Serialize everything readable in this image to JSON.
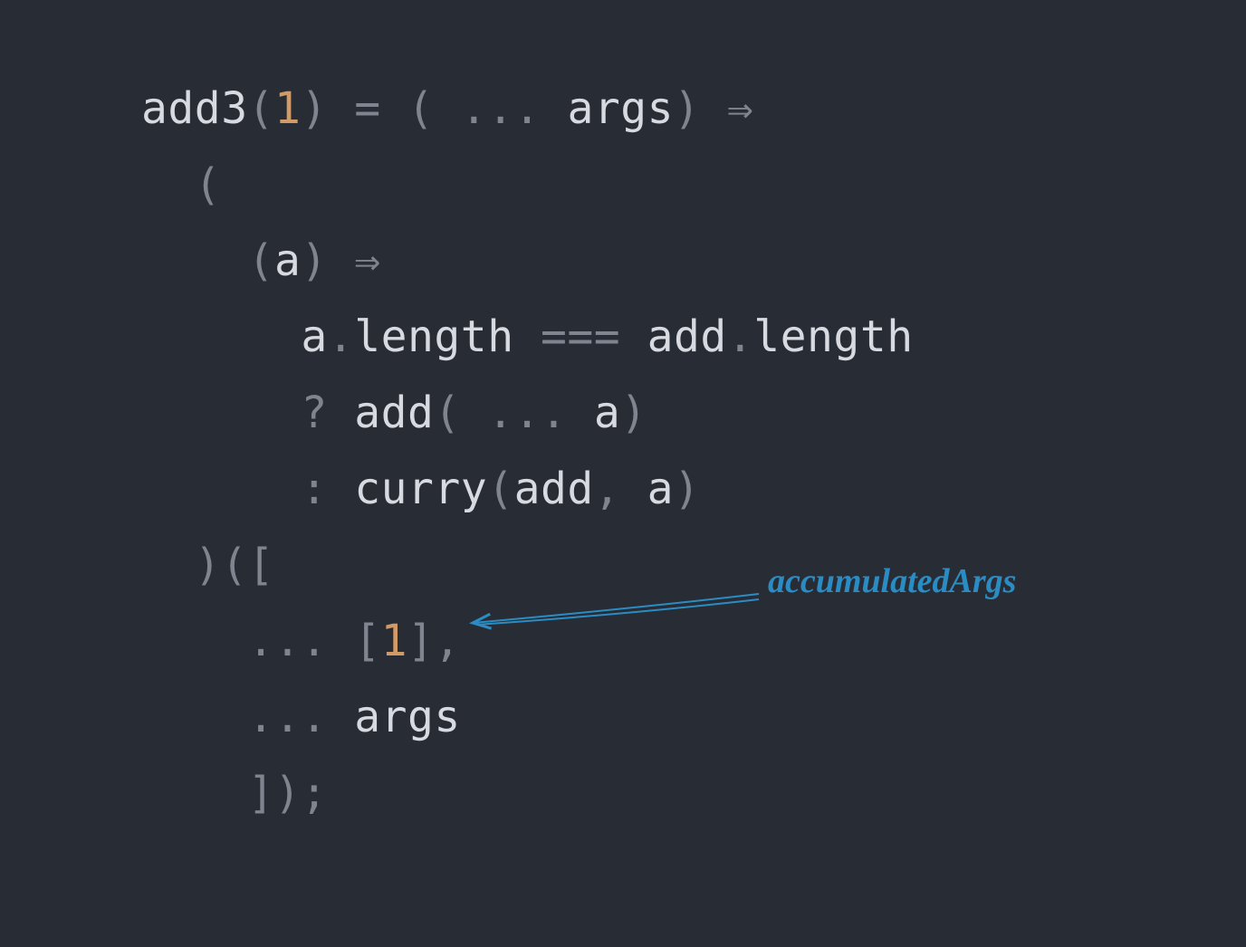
{
  "code": {
    "line1": {
      "t1": "add3",
      "p1": "(",
      "n1": "1",
      "p2": ")",
      "sp1": " ",
      "op1": "=",
      "sp2": " ",
      "p3": "(",
      "sp3": " ",
      "op2": "...",
      "sp4": " ",
      "t2": "args",
      "p4": ")",
      "sp5": " ",
      "op3": "⇒"
    },
    "line2": {
      "indent": "  ",
      "p1": "("
    },
    "line3": {
      "indent": "    ",
      "p1": "(",
      "t1": "a",
      "p2": ")",
      "sp1": " ",
      "op1": "⇒"
    },
    "line4": {
      "indent": "      ",
      "t1": "a",
      "p1": ".",
      "t2": "length",
      "sp1": " ",
      "op1": "===",
      "sp2": " ",
      "t3": "add",
      "p2": ".",
      "t4": "length"
    },
    "line5": {
      "indent": "      ",
      "op1": "?",
      "sp1": " ",
      "t1": "add",
      "p1": "(",
      "sp2": " ",
      "op2": "...",
      "sp3": " ",
      "t2": "a",
      "p2": ")"
    },
    "line6": {
      "indent": "      ",
      "op1": ":",
      "sp1": " ",
      "t1": "curry",
      "p1": "(",
      "t2": "add",
      "p2": ",",
      "sp2": " ",
      "t3": "a",
      "p3": ")"
    },
    "line7": {
      "indent": "  ",
      "p1": ")(["
    },
    "line8": {
      "indent": "    ",
      "op1": "...",
      "sp1": " ",
      "p1": "[",
      "n1": "1",
      "p2": "],"
    },
    "line9": {
      "indent": "    ",
      "op1": "...",
      "sp1": " ",
      "t1": "args"
    },
    "line10": {
      "indent": "    ",
      "p1": "]);"
    }
  },
  "annotation": {
    "label": "accumulatedArgs"
  },
  "colors": {
    "background": "#282c34",
    "text": "#d7dae0",
    "punct": "#7f848e",
    "number": "#d19a66",
    "annotation": "#2b8cc4"
  }
}
